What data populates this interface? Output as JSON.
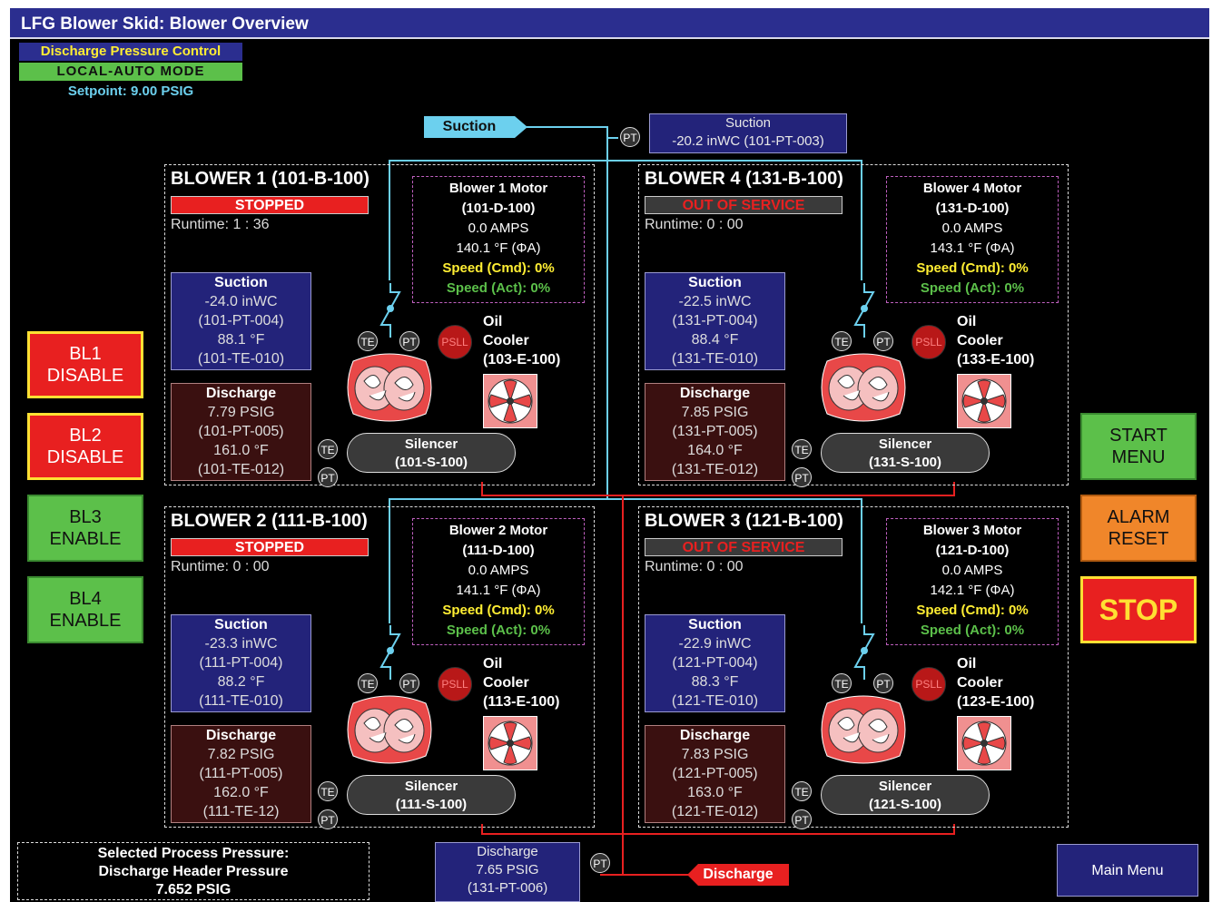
{
  "window": {
    "title": "LFG Blower Skid: Blower Overview"
  },
  "control": {
    "title": "Discharge Pressure Control",
    "mode": "LOCAL-AUTO MODE",
    "setpoint": "Setpoint: 9.00 PSIG"
  },
  "suction_header": {
    "tag": "Suction",
    "box_title": "Suction",
    "box_value": "-20.2 inWC (101-PT-003)",
    "instrument": "PT"
  },
  "discharge_header": {
    "tag": "Discharge",
    "box_title": "Discharge",
    "box_value": "7.65 PSIG",
    "box_id": "(131-PT-006)",
    "instrument": "PT"
  },
  "labels": {
    "suction": "Suction",
    "discharge": "Discharge",
    "oil": "Oil",
    "cooler": "Cooler",
    "silencer": "Silencer",
    "te": "TE",
    "pt": "PT",
    "psll": "PSLL"
  },
  "blowers": [
    {
      "title": "BLOWER 1 (101-B-100)",
      "status": "STOPPED",
      "runtime": "Runtime: 1 : 36",
      "motor": {
        "title": "Blower 1 Motor",
        "id": "(101-D-100)",
        "amps": "0.0 AMPS",
        "temp": "140.1 °F (ΦA)",
        "speed_cmd": "Speed (Cmd): 0%",
        "speed_act": "Speed (Act): 0%"
      },
      "suction": {
        "value": "-24.0 inWC",
        "pt": "(101-PT-004)",
        "temp": "88.1 °F",
        "te": "(101-TE-010)"
      },
      "discharge": {
        "value": "7.79 PSIG",
        "pt": "(101-PT-005)",
        "temp": "161.0 °F",
        "te": "(101-TE-012)"
      },
      "cooler_id": "(103-E-100)",
      "silencer_id": "(101-S-100)"
    },
    {
      "title": "BLOWER 4 (131-B-100)",
      "status": "OUT OF SERVICE",
      "runtime": "Runtime: 0 : 00",
      "motor": {
        "title": "Blower 4 Motor",
        "id": "(131-D-100)",
        "amps": "0.0 AMPS",
        "temp": "143.1 °F (ΦA)",
        "speed_cmd": "Speed (Cmd): 0%",
        "speed_act": "Speed (Act): 0%"
      },
      "suction": {
        "value": "-22.5 inWC",
        "pt": "(131-PT-004)",
        "temp": "88.4 °F",
        "te": "(131-TE-010)"
      },
      "discharge": {
        "value": "7.85 PSIG",
        "pt": "(131-PT-005)",
        "temp": "164.0 °F",
        "te": "(131-TE-012)"
      },
      "cooler_id": "(133-E-100)",
      "silencer_id": "(131-S-100)"
    },
    {
      "title": "BLOWER 2 (111-B-100)",
      "status": "STOPPED",
      "runtime": "Runtime: 0 : 00",
      "motor": {
        "title": "Blower 2 Motor",
        "id": "(111-D-100)",
        "amps": "0.0 AMPS",
        "temp": "141.1 °F (ΦA)",
        "speed_cmd": "Speed (Cmd): 0%",
        "speed_act": "Speed (Act): 0%"
      },
      "suction": {
        "value": "-23.3 inWC",
        "pt": "(111-PT-004)",
        "temp": "88.2 °F",
        "te": "(111-TE-010)"
      },
      "discharge": {
        "value": "7.82 PSIG",
        "pt": "(111-PT-005)",
        "temp": "162.0 °F",
        "te": "(111-TE-12)"
      },
      "cooler_id": "(113-E-100)",
      "silencer_id": "(111-S-100)"
    },
    {
      "title": "BLOWER 3 (121-B-100)",
      "status": "OUT OF SERVICE",
      "runtime": "Runtime: 0 : 00",
      "motor": {
        "title": "Blower 3 Motor",
        "id": "(121-D-100)",
        "amps": "0.0 AMPS",
        "temp": "142.1 °F (ΦA)",
        "speed_cmd": "Speed (Cmd): 0%",
        "speed_act": "Speed (Act): 0%"
      },
      "suction": {
        "value": "-22.9 inWC",
        "pt": "(121-PT-004)",
        "temp": "88.3 °F",
        "te": "(121-TE-010)"
      },
      "discharge": {
        "value": "7.83 PSIG",
        "pt": "(121-PT-005)",
        "temp": "163.0 °F",
        "te": "(121-TE-012)"
      },
      "cooler_id": "(123-E-100)",
      "silencer_id": "(121-S-100)"
    }
  ],
  "left_buttons": [
    {
      "line1": "BL1",
      "line2": "DISABLE",
      "style": "red"
    },
    {
      "line1": "BL2",
      "line2": "DISABLE",
      "style": "red"
    },
    {
      "line1": "BL3",
      "line2": "ENABLE",
      "style": "green"
    },
    {
      "line1": "BL4",
      "line2": "ENABLE",
      "style": "green"
    }
  ],
  "right_buttons": {
    "start": {
      "line1": "START",
      "line2": "MENU"
    },
    "alarm": {
      "line1": "ALARM",
      "line2": "RESET"
    },
    "stop": "STOP"
  },
  "selected_pressure": {
    "line1": "Selected Process Pressure:",
    "line2": "Discharge Header Pressure",
    "line3": "7.652 PSIG"
  },
  "main_menu": "Main Menu",
  "colors": {
    "titlebar": "#2b2e8f",
    "suction_pipe": "#6cd0ee",
    "discharge_pipe": "#e82020",
    "ok_green": "#5cc04a",
    "alarm_red": "#e82020"
  }
}
